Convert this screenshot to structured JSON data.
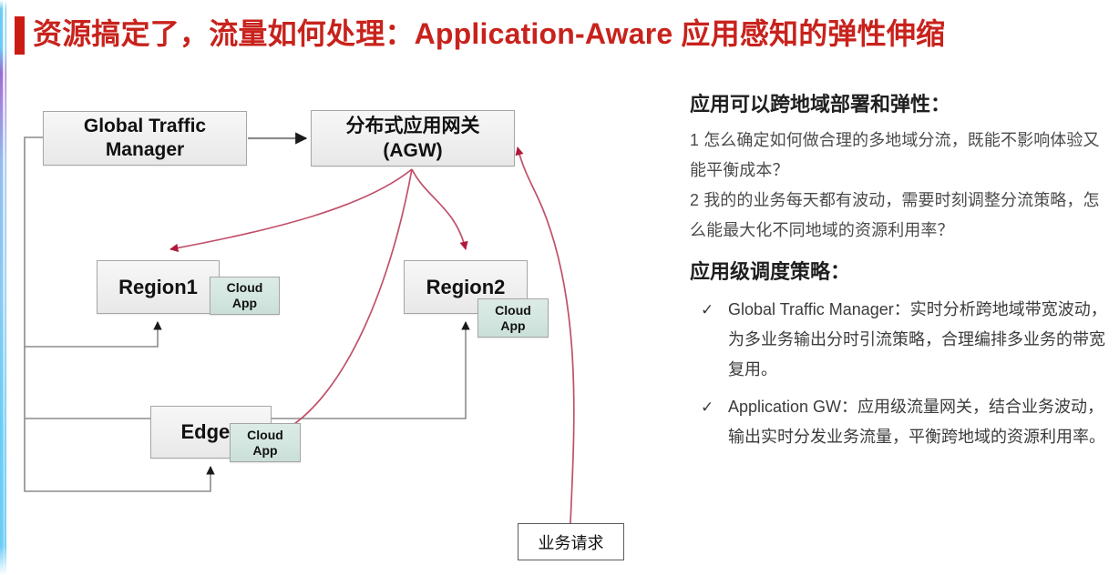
{
  "title": "资源搞定了，流量如何处理：Application-Aware 应用感知的弹性伸缩",
  "colors": {
    "title_red": "#c8221c",
    "accent_bar": "#cc1b13",
    "node_fill": "#efefef",
    "cloudapp_fill": "#d2e6df",
    "connector_pink": "#c0506a",
    "connector_gray": "#8c8c8c",
    "edge_stripe_blue": "#5fc8f5",
    "edge_stripe_purple": "#8f5fd0"
  },
  "diagram": {
    "nodes": {
      "gtm": "Global Traffic\nManager",
      "gtm_line1": "Global Traffic",
      "gtm_line2": "Manager",
      "agw_line1": "分布式应用网关",
      "agw_line2": "(AGW)",
      "region1": "Region1",
      "region2": "Region2",
      "edge3": "Edge3",
      "request": "业务请求",
      "cloud_app": "Cloud App",
      "cloud_app_line1": "Cloud",
      "cloud_app_line2": "App"
    }
  },
  "right_panel": {
    "heading1": "应用可以跨地域部署和弹性：",
    "para1": "1 怎么确定如何做合理的多地域分流，既能不影响体验又能平衡成本？",
    "para2": "2 我的的业务每天都有波动，需要时刻调整分流策略，怎么能最大化不同地域的资源利用率？",
    "heading2": "应用级调度策略：",
    "bullets": [
      {
        "check": "✓",
        "text": "Global Traffic Manager：实时分析跨地域带宽波动，为多业务输出分时引流策略，合理编排多业务的带宽复用。"
      },
      {
        "check": "✓",
        "text": "Application GW：应用级流量网关，结合业务波动，输出实时分发业务流量，平衡跨地域的资源利用率。"
      }
    ]
  }
}
